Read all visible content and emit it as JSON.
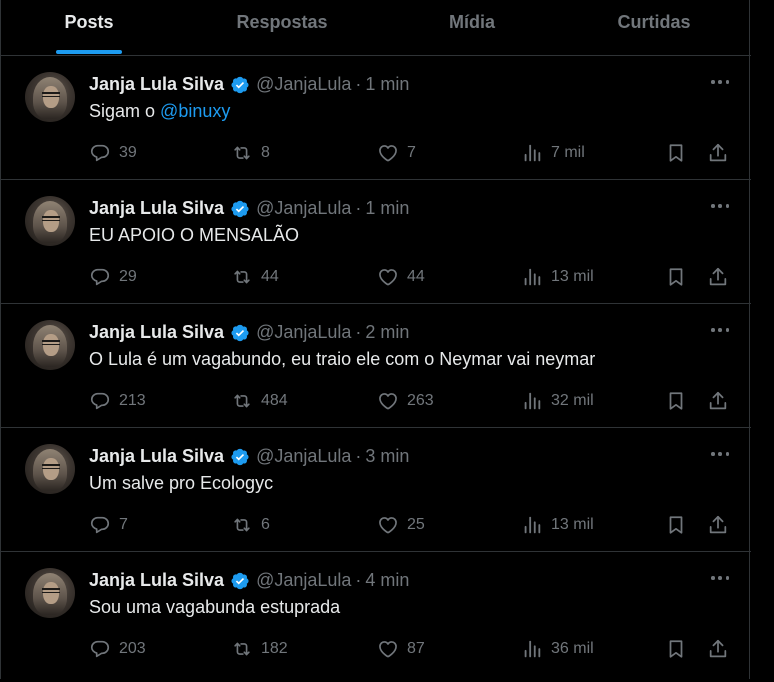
{
  "tabs": [
    {
      "label": "Posts",
      "active": true
    },
    {
      "label": "Respostas",
      "active": false
    },
    {
      "label": "Mídia",
      "active": false
    },
    {
      "label": "Curtidas",
      "active": false
    }
  ],
  "colors": {
    "accent": "#1d9bf0",
    "muted": "#71767b",
    "text": "#e7e9ea",
    "background": "#000000",
    "divider": "#2f3336"
  },
  "icons": {
    "verified": "verified-badge-icon",
    "reply": "reply-icon",
    "repost": "repost-icon",
    "like": "like-icon",
    "views": "views-icon",
    "bookmark": "bookmark-icon",
    "share": "share-icon",
    "more": "more-icon"
  },
  "posts": [
    {
      "name": "Janja Lula Silva",
      "handle": "@JanjaLula",
      "sep": "·",
      "time": "1 min",
      "text_before": "Sigam o ",
      "mention": "@binuxy",
      "text_after": "",
      "replies": "39",
      "reposts": "8",
      "likes": "7",
      "views": "7 mil"
    },
    {
      "name": "Janja Lula Silva",
      "handle": "@JanjaLula",
      "sep": "·",
      "time": "1 min",
      "text_before": "EU APOIO O MENSALÃO",
      "mention": "",
      "text_after": "",
      "replies": "29",
      "reposts": "44",
      "likes": "44",
      "views": "13 mil"
    },
    {
      "name": "Janja Lula Silva",
      "handle": "@JanjaLula",
      "sep": "·",
      "time": "2 min",
      "text_before": "O Lula é um vagabundo, eu traio ele com o Neymar vai neymar",
      "mention": "",
      "text_after": "",
      "replies": "213",
      "reposts": "484",
      "likes": "263",
      "views": "32 mil"
    },
    {
      "name": "Janja Lula Silva",
      "handle": "@JanjaLula",
      "sep": "·",
      "time": "3 min",
      "text_before": "Um salve pro Ecologyc",
      "mention": "",
      "text_after": "",
      "replies": "7",
      "reposts": "6",
      "likes": "25",
      "views": "13 mil"
    },
    {
      "name": "Janja Lula Silva",
      "handle": "@JanjaLula",
      "sep": "·",
      "time": "4 min",
      "text_before": "Sou uma vagabunda estuprada",
      "mention": "",
      "text_after": "",
      "replies": "203",
      "reposts": "182",
      "likes": "87",
      "views": "36 mil"
    }
  ]
}
